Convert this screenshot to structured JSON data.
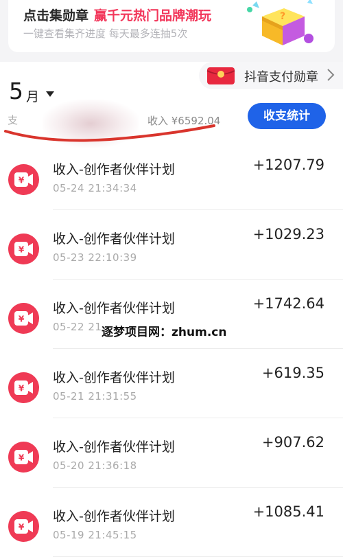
{
  "promo": {
    "headline_dark": "点击集勋章",
    "headline_red": "赢千元热门品牌潮玩",
    "subline": "一键查看集齐进度  每天最多连抽5次"
  },
  "badge_entry": {
    "label": "抖音支付勋章",
    "icon": "red-envelope-icon"
  },
  "month_picker": {
    "month": "5",
    "unit": "月",
    "icon": "caret-down-icon"
  },
  "summary": {
    "expense_label": "支",
    "income_text": "收入 ¥6592.04",
    "stats_button": "收支统计"
  },
  "transactions": [
    {
      "title": "收入-创作者伙伴计划",
      "time": "05-24 21:34:34",
      "amount": "+1207.79"
    },
    {
      "title": "收入-创作者伙伴计划",
      "time": "05-23 22:10:39",
      "amount": "+1029.23"
    },
    {
      "title": "收入-创作者伙伴计划",
      "time": "05-22 21",
      "amount": "+1742.64"
    },
    {
      "title": "收入-创作者伙伴计划",
      "time": "05-21 21:31:55",
      "amount": "+619.35"
    },
    {
      "title": "收入-创作者伙伴计划",
      "time": "05-20 21:36:18",
      "amount": "+907.62"
    },
    {
      "title": "收入-创作者伙伴计划",
      "time": "05-19 21:45:15",
      "amount": "+1085.41"
    }
  ],
  "watermark": "逐梦项目网：zhum.cn",
  "colors": {
    "accent_blue": "#1f63e8",
    "accent_red": "#f2365a",
    "icon_red": "#ef3a55"
  }
}
